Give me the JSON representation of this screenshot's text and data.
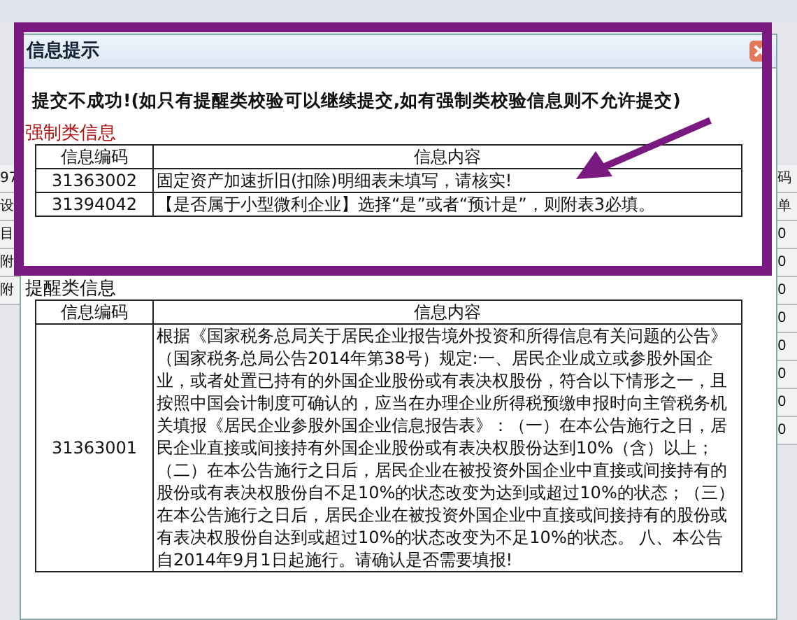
{
  "background": {
    "left_cells": [
      "97",
      "设",
      "目",
      "附",
      "附"
    ],
    "right_cells": [
      "码",
      "单",
      "0",
      "0",
      "0",
      "0",
      "0",
      "0",
      "0",
      "0"
    ]
  },
  "window": {
    "title": "信息提示"
  },
  "message": "提交不成功!(如只有提醒类校验可以继续提交,如有强制类校验信息则不允许提交)",
  "sections": [
    {
      "kind": "mandatory",
      "title": "强制类信息",
      "columns": [
        "信息编码",
        "信息内容"
      ],
      "rows": [
        {
          "code": "31363002",
          "content": "固定资产加速折旧(扣除)明细表未填写，请核实!"
        },
        {
          "code": "31394042",
          "content": "【是否属于小型微利企业】选择“是”或者“预计是”，则附表3必填。"
        }
      ]
    },
    {
      "kind": "reminder",
      "title": "提醒类信息",
      "columns": [
        "信息编码",
        "信息内容"
      ],
      "rows": [
        {
          "code": "31363001",
          "content": "根据《国家税务总局关于居民企业报告境外投资和所得信息有关问题的公告》（国家税务总局公告2014年第38号）规定:一、居民企业成立或参股外国企业，或者处置已持有的外国企业股份或有表决权股份，符合以下情形之一，且按照中国会计制度可确认的，应当在办理企业所得税预缴申报时向主管税务机关填报《居民企业参股外国企业信息报告表》：（一）在本公告施行之日，居民企业直接或间接持有外国企业股份或有表决权股份达到10%（含）以上；（二）在本公告施行之日后，居民企业在被投资外国企业中直接或间接持有的股份或有表决权股份自不足10%的状态改变为达到或超过10%的状态；（三）在本公告施行之日后，居民企业在被投资外国企业中直接或间接持有的股份或有表决权股份自达到或超过10%的状态改变为不足10%的状态。 八、本公告自2014年9月1日起施行。请确认是否需要填报!"
        }
      ]
    }
  ],
  "annotation": {
    "kind": "highlight"
  }
}
